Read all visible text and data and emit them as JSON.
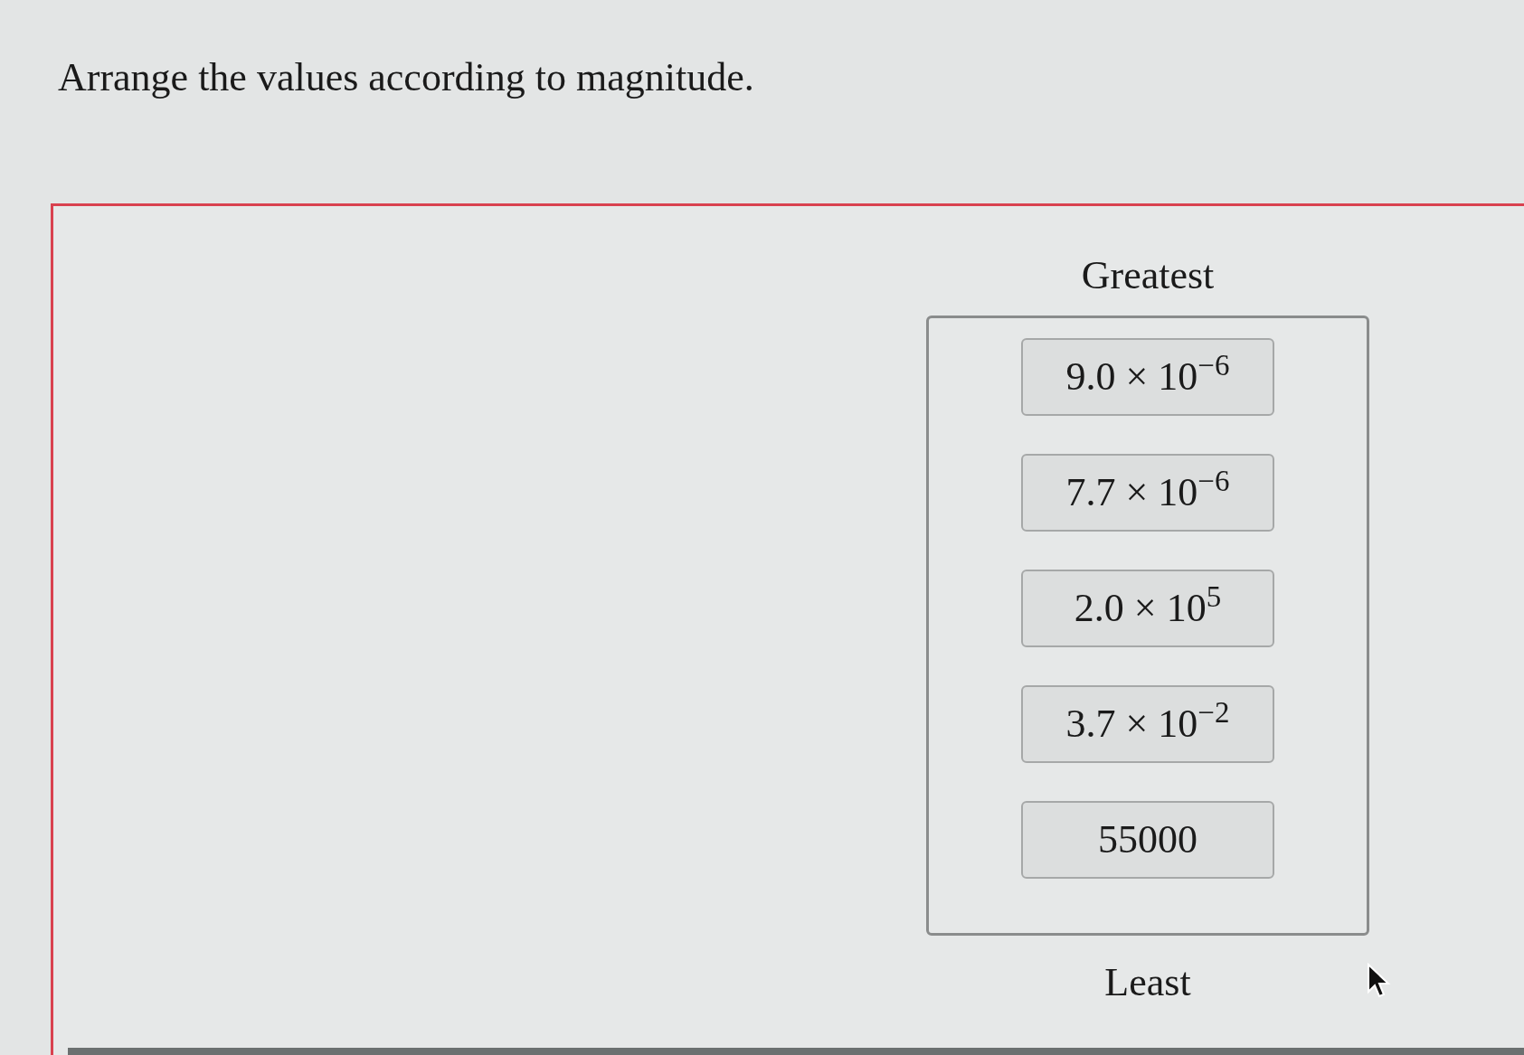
{
  "question": "Arrange the values according to magnitude.",
  "top_label": "Greatest",
  "items": [
    {
      "value": "9.0 × 10$^{−6}$"
    },
    {
      "value": "7.7 × 10$^{−6}$"
    },
    {
      "value": "2.0 × 10$^{5}$"
    },
    {
      "value": "3.7 × 10$^{−2}$"
    },
    {
      "value": "55000"
    }
  ],
  "bottom_label": "Least"
}
